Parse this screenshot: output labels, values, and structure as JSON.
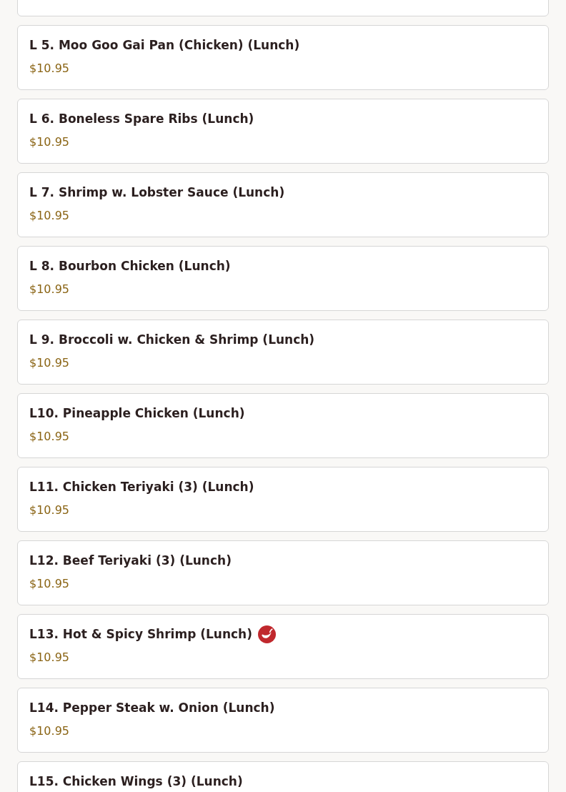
{
  "menu_items": [
    {
      "name": "L 5. Moo Goo Gai Pan (Chicken) (Lunch)",
      "price": "$10.95",
      "spicy": false
    },
    {
      "name": "L 6. Boneless Spare Ribs (Lunch)",
      "price": "$10.95",
      "spicy": false
    },
    {
      "name": "L 7. Shrimp w. Lobster Sauce (Lunch)",
      "price": "$10.95",
      "spicy": false
    },
    {
      "name": "L 8. Bourbon Chicken (Lunch)",
      "price": "$10.95",
      "spicy": false
    },
    {
      "name": "L 9. Broccoli w. Chicken & Shrimp (Lunch)",
      "price": "$10.95",
      "spicy": false
    },
    {
      "name": "L10. Pineapple Chicken (Lunch)",
      "price": "$10.95",
      "spicy": false
    },
    {
      "name": "L11. Chicken Teriyaki (3) (Lunch)",
      "price": "$10.95",
      "spicy": false
    },
    {
      "name": "L12. Beef Teriyaki (3) (Lunch)",
      "price": "$10.95",
      "spicy": false
    },
    {
      "name": "L13. Hot & Spicy Shrimp (Lunch)",
      "price": "$10.95",
      "spicy": true
    },
    {
      "name": "L14. Pepper Steak w. Onion (Lunch)",
      "price": "$10.95",
      "spicy": false
    },
    {
      "name": "L15. Chicken Wings (3) (Lunch)",
      "spicy": false
    }
  ]
}
